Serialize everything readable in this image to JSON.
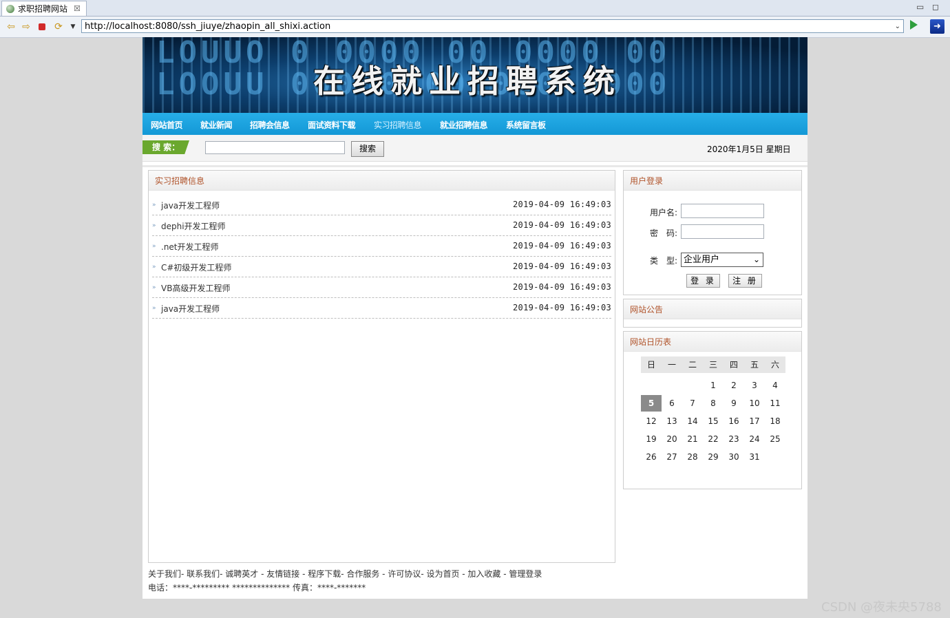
{
  "browser": {
    "tab_title": "求职招聘网站",
    "tab_close": "☒",
    "url": "http://localhost:8080/ssh_jiuye/zhaopin_all_shixi.action"
  },
  "banner": {
    "title": "在线就业招聘系统",
    "digits": [
      "LOUUO 0 0000 00 0000 00",
      "LOOUU 00000 000000 0000"
    ]
  },
  "menu": {
    "items": [
      "网站首页",
      "就业新闻",
      "招聘会信息",
      "面试资料下载",
      "实习招聘信息",
      "就业招聘信息",
      "系统留言板"
    ],
    "active_index": 4
  },
  "search": {
    "label": "搜 索：",
    "button": "搜索",
    "date": "2020年1月5日 星期日"
  },
  "main": {
    "heading": "实习招聘信息",
    "bullet": "»",
    "jobs": [
      {
        "title": "java开发工程师",
        "time": "2019-04-09 16:49:03"
      },
      {
        "title": "dephi开发工程师",
        "time": "2019-04-09 16:49:03"
      },
      {
        "title": ".net开发工程师",
        "time": "2019-04-09 16:49:03"
      },
      {
        "title": "C#初级开发工程师",
        "time": "2019-04-09 16:49:03"
      },
      {
        "title": "VB高级开发工程师",
        "time": "2019-04-09 16:49:03"
      },
      {
        "title": "java开发工程师",
        "time": "2019-04-09 16:49:03"
      }
    ]
  },
  "login": {
    "heading": "用户登录",
    "username_label": "用户名:",
    "password_label": "密　码:",
    "type_label": "类　型:",
    "type_value": "企业用户",
    "login_button": "登 录",
    "register_button": "注 册"
  },
  "notice": {
    "heading": "网站公告"
  },
  "calendar": {
    "heading": "网站日历表",
    "weekdays": [
      "日",
      "一",
      "二",
      "三",
      "四",
      "五",
      "六"
    ],
    "weeks": [
      [
        "",
        "",
        "",
        "1",
        "2",
        "3",
        "4"
      ],
      [
        "5",
        "6",
        "7",
        "8",
        "9",
        "10",
        "11"
      ],
      [
        "12",
        "13",
        "14",
        "15",
        "16",
        "17",
        "18"
      ],
      [
        "19",
        "20",
        "21",
        "22",
        "23",
        "24",
        "25"
      ],
      [
        "26",
        "27",
        "28",
        "29",
        "30",
        "31",
        ""
      ]
    ],
    "today": "5"
  },
  "footer": {
    "links": "关于我们- 联系我们- 诚聘英才 - 友情链接 - 程序下载- 合作服务 - 许可协议- 设为首页 - 加入收藏 - 管理登录",
    "contact": "电话：****-********* ************** 传真：****-*******"
  },
  "watermark": "CSDN @夜未央5788"
}
